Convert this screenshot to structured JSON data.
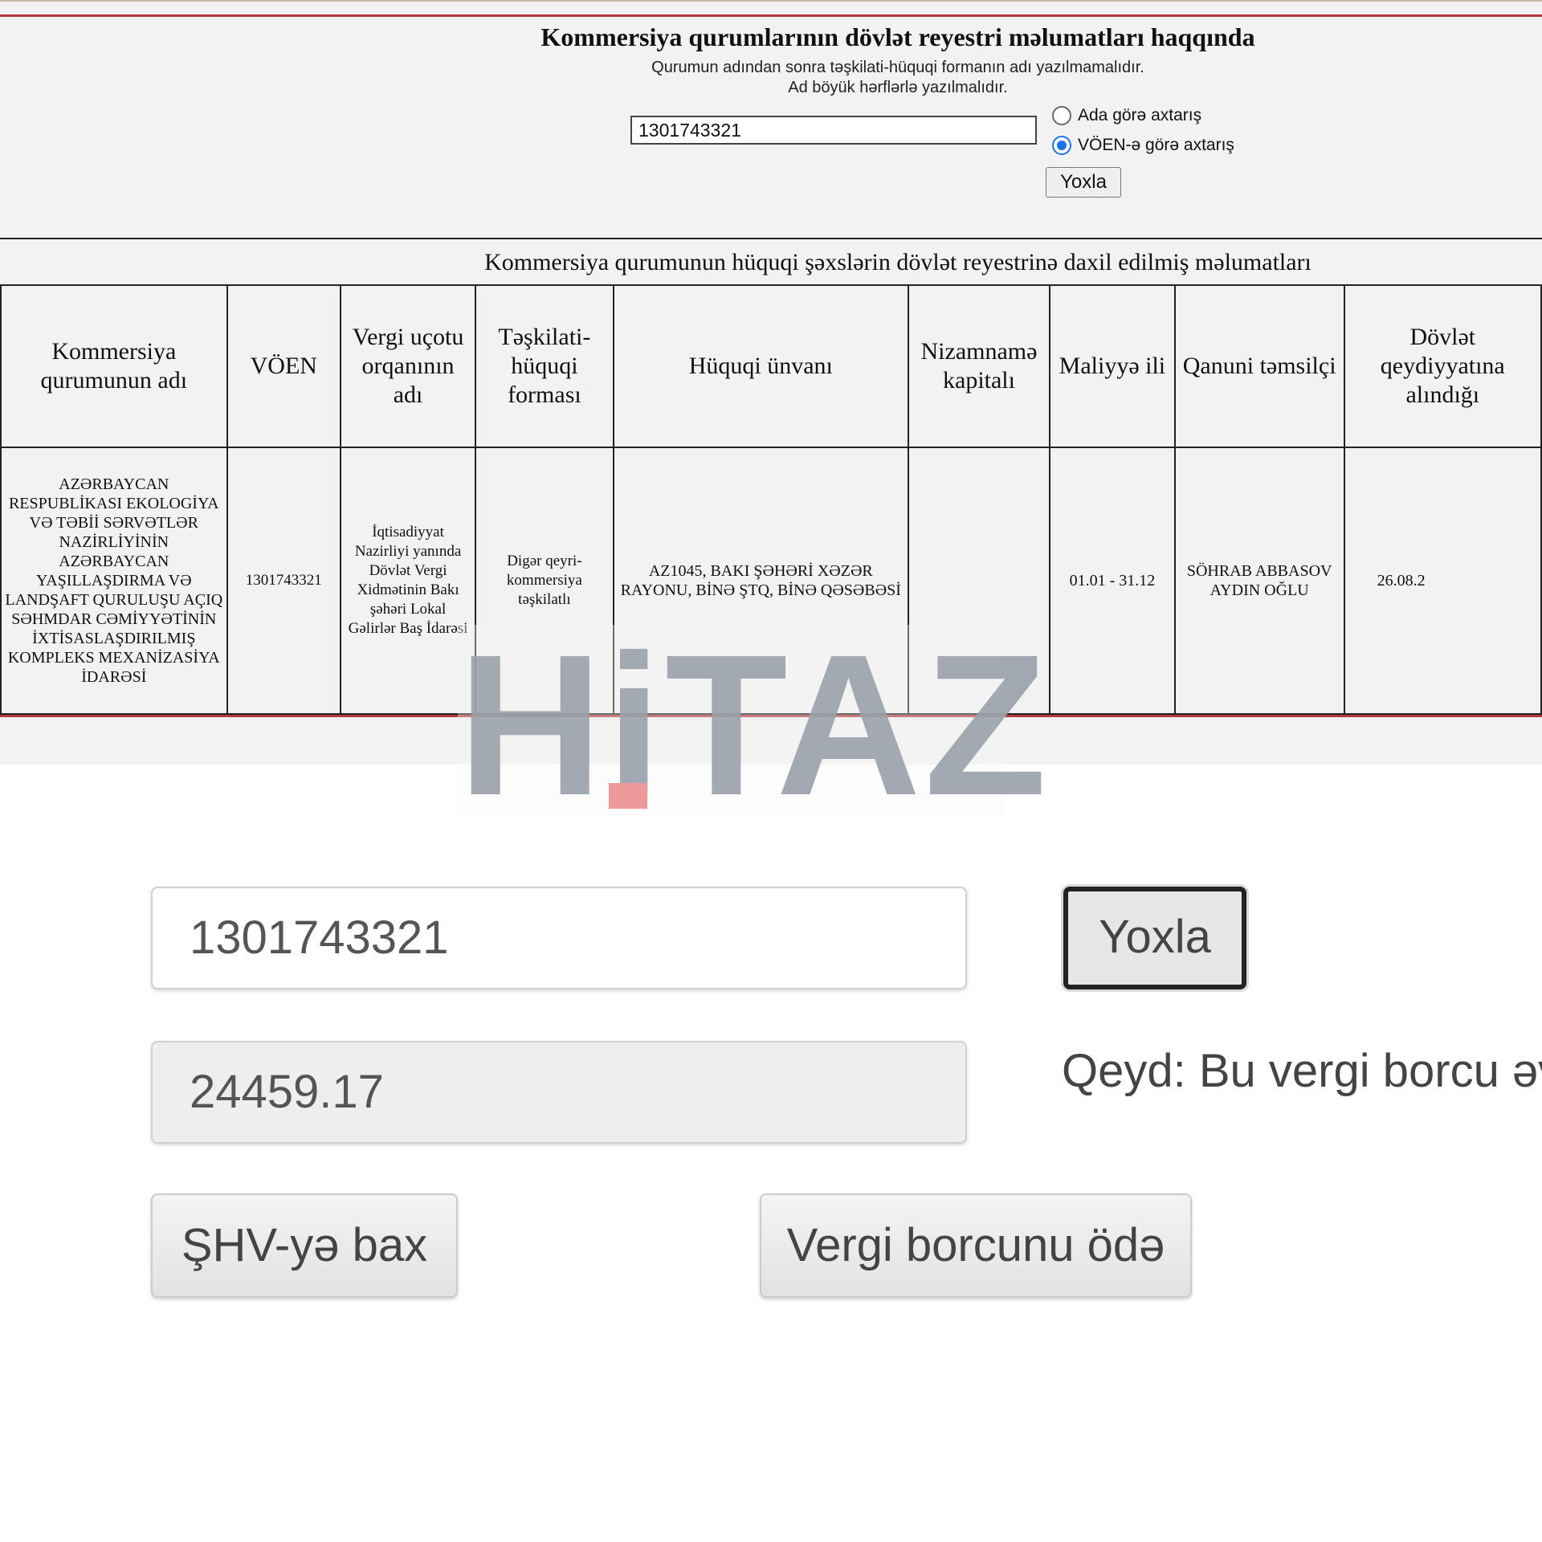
{
  "registry": {
    "title": "Kommersiya qurumlarının dövlət reyestri məlumatları haqqında",
    "note_1": "Qurumun adından sonra təşkilati-hüquqi formanın adı yazılmamalıdır.",
    "note_2": "Ad böyük hərflərlə yazılmalıdır.",
    "search_value": "1301743321",
    "radio_options": [
      {
        "label": "Ada görə axtarış",
        "checked": false
      },
      {
        "label": "VÖEN-ə görə axtarış",
        "checked": true
      }
    ],
    "check_button": "Yoxla",
    "section_title": "Kommersiya qurumunun hüquqi şəxslərin dövlət reyestrinə daxil edilmiş məlumatları",
    "columns": [
      "Kommersiya qurumunun adı",
      "VÖEN",
      "Vergi uçotu orqanının adı",
      "Təşkilati-hüquqi forması",
      "Hüquqi ünvanı",
      "Nizamnamə kapitalı",
      "Maliyyə ili",
      "Qanuni təmsilçi",
      "Dövlət qeydiyyatına alındığı"
    ],
    "row": {
      "name": "AZƏRBAYCAN RESPUBLİKASI EKOLOGİYA Və TƏBİİ SƏRVƏTLƏR NAZİRLİYİNİN AZƏRBAYCAN YAŞILLAŞDIRMA Və LANDŞAFT QURULUŞU AÇIQ SƏHMDAR CƏMİYYƏTİNİN İXTİSASLAŞDIRILMIŞ KOMPLEKS MEXANİZASİYA İDARƏSİ",
      "voen": "1301743321",
      "tax_office": "İqtisadiyyat Nazirliyi yanında Dövlət Vergi Xidmətinin Bakı şəhəri Lokal Gəlirlər Baş İdarəsi",
      "legal_form": "Digər qeyri-kommersiya təşkilatlı",
      "address": "AZ1045, BAKI ŞƏHƏRİ XƏZƏR RAYONU, BİNƏ ŞTQ, BİNƏ QƏSƏBƏSİ",
      "capital": "",
      "fiscal_year": "01.01 - 31.12",
      "representative": "SÖHRAB ABBASOV AYDIN OĞLU",
      "registration_date": "26.08.2"
    }
  },
  "watermark": {
    "text": "HiTAZ"
  },
  "debt": {
    "voen_value": "1301743321",
    "check_button": "Yoxla",
    "amount_value": "24459.17",
    "note": "Qeyd: Bu vergi borcu əvv",
    "view_button": "ŞHV-yə bax",
    "pay_button": "Vergi borcunu ödə"
  }
}
